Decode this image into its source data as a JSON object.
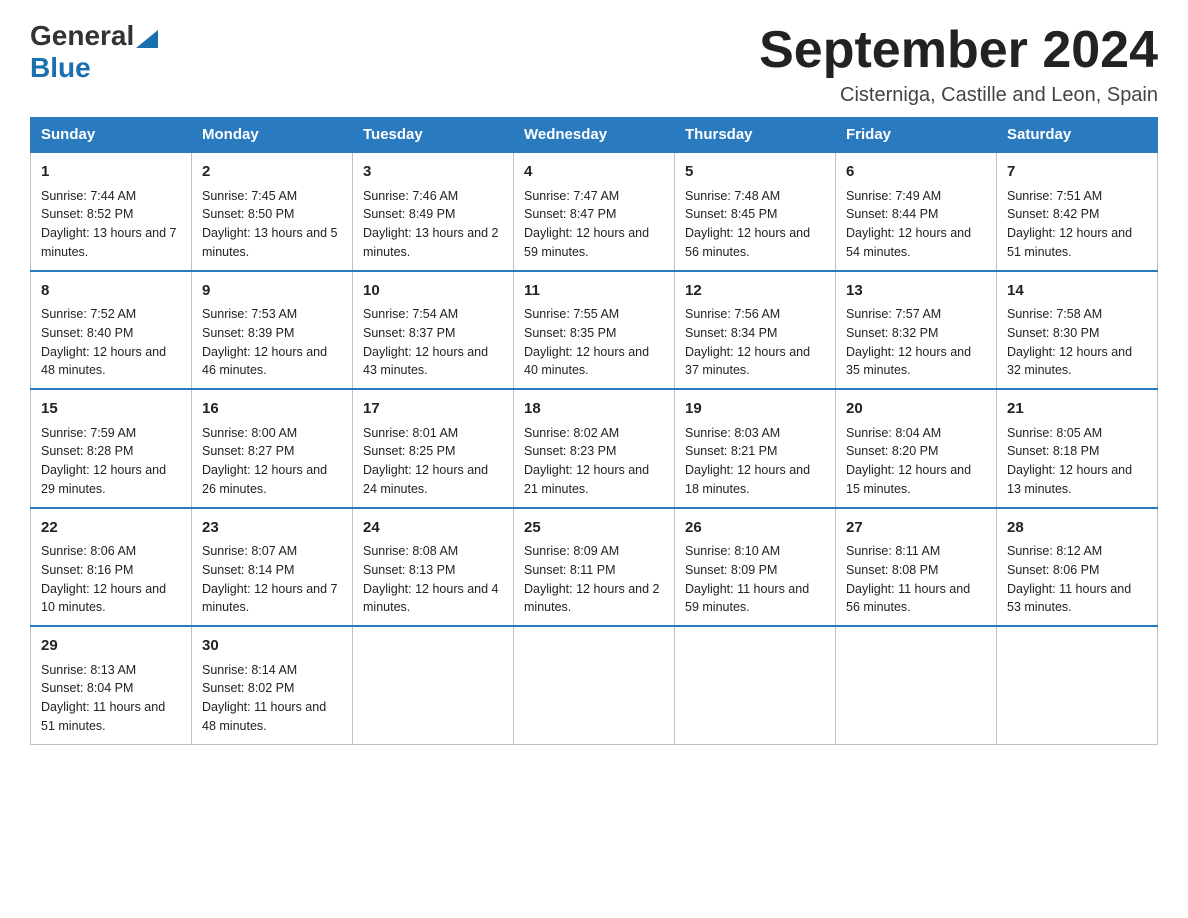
{
  "header": {
    "logo_general": "General",
    "logo_blue": "Blue",
    "month_title": "September 2024",
    "location": "Cisterniga, Castille and Leon, Spain"
  },
  "weekdays": [
    "Sunday",
    "Monday",
    "Tuesday",
    "Wednesday",
    "Thursday",
    "Friday",
    "Saturday"
  ],
  "weeks": [
    [
      {
        "day": "1",
        "sunrise": "7:44 AM",
        "sunset": "8:52 PM",
        "daylight": "13 hours and 7 minutes."
      },
      {
        "day": "2",
        "sunrise": "7:45 AM",
        "sunset": "8:50 PM",
        "daylight": "13 hours and 5 minutes."
      },
      {
        "day": "3",
        "sunrise": "7:46 AM",
        "sunset": "8:49 PM",
        "daylight": "13 hours and 2 minutes."
      },
      {
        "day": "4",
        "sunrise": "7:47 AM",
        "sunset": "8:47 PM",
        "daylight": "12 hours and 59 minutes."
      },
      {
        "day": "5",
        "sunrise": "7:48 AM",
        "sunset": "8:45 PM",
        "daylight": "12 hours and 56 minutes."
      },
      {
        "day": "6",
        "sunrise": "7:49 AM",
        "sunset": "8:44 PM",
        "daylight": "12 hours and 54 minutes."
      },
      {
        "day": "7",
        "sunrise": "7:51 AM",
        "sunset": "8:42 PM",
        "daylight": "12 hours and 51 minutes."
      }
    ],
    [
      {
        "day": "8",
        "sunrise": "7:52 AM",
        "sunset": "8:40 PM",
        "daylight": "12 hours and 48 minutes."
      },
      {
        "day": "9",
        "sunrise": "7:53 AM",
        "sunset": "8:39 PM",
        "daylight": "12 hours and 46 minutes."
      },
      {
        "day": "10",
        "sunrise": "7:54 AM",
        "sunset": "8:37 PM",
        "daylight": "12 hours and 43 minutes."
      },
      {
        "day": "11",
        "sunrise": "7:55 AM",
        "sunset": "8:35 PM",
        "daylight": "12 hours and 40 minutes."
      },
      {
        "day": "12",
        "sunrise": "7:56 AM",
        "sunset": "8:34 PM",
        "daylight": "12 hours and 37 minutes."
      },
      {
        "day": "13",
        "sunrise": "7:57 AM",
        "sunset": "8:32 PM",
        "daylight": "12 hours and 35 minutes."
      },
      {
        "day": "14",
        "sunrise": "7:58 AM",
        "sunset": "8:30 PM",
        "daylight": "12 hours and 32 minutes."
      }
    ],
    [
      {
        "day": "15",
        "sunrise": "7:59 AM",
        "sunset": "8:28 PM",
        "daylight": "12 hours and 29 minutes."
      },
      {
        "day": "16",
        "sunrise": "8:00 AM",
        "sunset": "8:27 PM",
        "daylight": "12 hours and 26 minutes."
      },
      {
        "day": "17",
        "sunrise": "8:01 AM",
        "sunset": "8:25 PM",
        "daylight": "12 hours and 24 minutes."
      },
      {
        "day": "18",
        "sunrise": "8:02 AM",
        "sunset": "8:23 PM",
        "daylight": "12 hours and 21 minutes."
      },
      {
        "day": "19",
        "sunrise": "8:03 AM",
        "sunset": "8:21 PM",
        "daylight": "12 hours and 18 minutes."
      },
      {
        "day": "20",
        "sunrise": "8:04 AM",
        "sunset": "8:20 PM",
        "daylight": "12 hours and 15 minutes."
      },
      {
        "day": "21",
        "sunrise": "8:05 AM",
        "sunset": "8:18 PM",
        "daylight": "12 hours and 13 minutes."
      }
    ],
    [
      {
        "day": "22",
        "sunrise": "8:06 AM",
        "sunset": "8:16 PM",
        "daylight": "12 hours and 10 minutes."
      },
      {
        "day": "23",
        "sunrise": "8:07 AM",
        "sunset": "8:14 PM",
        "daylight": "12 hours and 7 minutes."
      },
      {
        "day": "24",
        "sunrise": "8:08 AM",
        "sunset": "8:13 PM",
        "daylight": "12 hours and 4 minutes."
      },
      {
        "day": "25",
        "sunrise": "8:09 AM",
        "sunset": "8:11 PM",
        "daylight": "12 hours and 2 minutes."
      },
      {
        "day": "26",
        "sunrise": "8:10 AM",
        "sunset": "8:09 PM",
        "daylight": "11 hours and 59 minutes."
      },
      {
        "day": "27",
        "sunrise": "8:11 AM",
        "sunset": "8:08 PM",
        "daylight": "11 hours and 56 minutes."
      },
      {
        "day": "28",
        "sunrise": "8:12 AM",
        "sunset": "8:06 PM",
        "daylight": "11 hours and 53 minutes."
      }
    ],
    [
      {
        "day": "29",
        "sunrise": "8:13 AM",
        "sunset": "8:04 PM",
        "daylight": "11 hours and 51 minutes."
      },
      {
        "day": "30",
        "sunrise": "8:14 AM",
        "sunset": "8:02 PM",
        "daylight": "11 hours and 48 minutes."
      },
      null,
      null,
      null,
      null,
      null
    ]
  ]
}
